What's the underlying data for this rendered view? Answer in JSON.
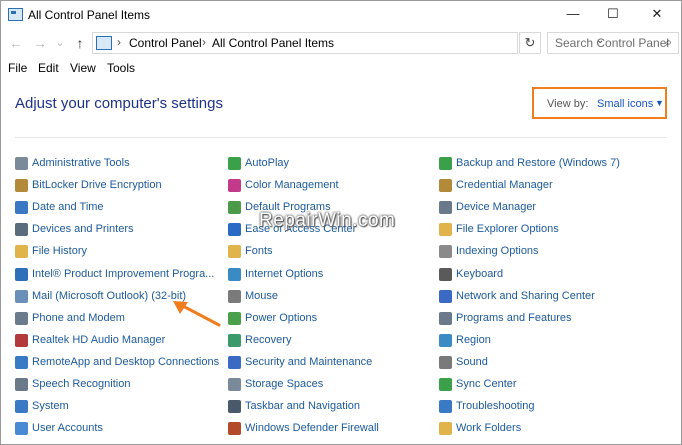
{
  "window": {
    "title": "All Control Panel Items",
    "controls": {
      "minimize": "—",
      "maximize": "☐",
      "close": "✕"
    }
  },
  "nav": {
    "back": "←",
    "forward": "→",
    "dropdown": "⌄",
    "up": "↑",
    "breadcrumb": [
      "Control Panel",
      "All Control Panel Items"
    ],
    "separator": "›",
    "address_dropdown": "⌄",
    "refresh": "↻",
    "search_placeholder": "Search Control Panel",
    "search_icon": "⌕"
  },
  "menu": [
    "File",
    "Edit",
    "View",
    "Tools"
  ],
  "heading": "Adjust your computer's settings",
  "view_by": {
    "label": "View by:",
    "value": "Small icons",
    "caret": "▼"
  },
  "columns": [
    [
      {
        "label": "Administrative Tools",
        "icon": "admin-tools-icon",
        "color": "#7a8a99"
      },
      {
        "label": "BitLocker Drive Encryption",
        "icon": "bitlocker-icon",
        "color": "#b38a3a"
      },
      {
        "label": "Date and Time",
        "icon": "date-time-icon",
        "color": "#3a78c4"
      },
      {
        "label": "Devices and Printers",
        "icon": "devices-printers-icon",
        "color": "#5b6c7e"
      },
      {
        "label": "File History",
        "icon": "file-history-icon",
        "color": "#e0b44a"
      },
      {
        "label": "Intel® Product Improvement Progra...",
        "icon": "intel-icon",
        "color": "#2f6fba"
      },
      {
        "label": "Mail (Microsoft Outlook) (32-bit)",
        "icon": "mail-icon",
        "color": "#6a8fb8"
      },
      {
        "label": "Phone and Modem",
        "icon": "phone-modem-icon",
        "color": "#6b7b8b"
      },
      {
        "label": "Realtek HD Audio Manager",
        "icon": "realtek-icon",
        "color": "#b33a3a"
      },
      {
        "label": "RemoteApp and Desktop Connections",
        "icon": "remoteapp-icon",
        "color": "#3a7ac4"
      },
      {
        "label": "Speech Recognition",
        "icon": "speech-icon",
        "color": "#6a7a8a"
      },
      {
        "label": "System",
        "icon": "system-icon",
        "color": "#3a7ac4"
      },
      {
        "label": "User Accounts",
        "icon": "user-accounts-icon",
        "color": "#4a8ad4"
      }
    ],
    [
      {
        "label": "AutoPlay",
        "icon": "autoplay-icon",
        "color": "#3aa04a"
      },
      {
        "label": "Color Management",
        "icon": "color-management-icon",
        "color": "#c43a8a"
      },
      {
        "label": "Default Programs",
        "icon": "default-programs-icon",
        "color": "#4a9a4a"
      },
      {
        "label": "Ease of Access Center",
        "icon": "ease-of-access-icon",
        "color": "#2a6ac4"
      },
      {
        "label": "Fonts",
        "icon": "fonts-icon",
        "color": "#e0b44a"
      },
      {
        "label": "Internet Options",
        "icon": "internet-options-icon",
        "color": "#3a8ac4"
      },
      {
        "label": "Mouse",
        "icon": "mouse-icon",
        "color": "#7a7a7a"
      },
      {
        "label": "Power Options",
        "icon": "power-options-icon",
        "color": "#4aa04a"
      },
      {
        "label": "Recovery",
        "icon": "recovery-icon",
        "color": "#3a9a6a"
      },
      {
        "label": "Security and Maintenance",
        "icon": "security-flag-icon",
        "color": "#3a6ac4"
      },
      {
        "label": "Storage Spaces",
        "icon": "storage-spaces-icon",
        "color": "#7a8a9a"
      },
      {
        "label": "Taskbar and Navigation",
        "icon": "taskbar-icon",
        "color": "#4a5a6a"
      },
      {
        "label": "Windows Defender Firewall",
        "icon": "firewall-icon",
        "color": "#b34a2a"
      }
    ],
    [
      {
        "label": "Backup and Restore (Windows 7)",
        "icon": "backup-restore-icon",
        "color": "#3aa04a"
      },
      {
        "label": "Credential Manager",
        "icon": "credential-manager-icon",
        "color": "#b38a3a"
      },
      {
        "label": "Device Manager",
        "icon": "device-manager-icon",
        "color": "#6a7a8a"
      },
      {
        "label": "File Explorer Options",
        "icon": "folder-options-icon",
        "color": "#e0b44a"
      },
      {
        "label": "Indexing Options",
        "icon": "indexing-options-icon",
        "color": "#8a8a8a"
      },
      {
        "label": "Keyboard",
        "icon": "keyboard-icon",
        "color": "#5a5a5a"
      },
      {
        "label": "Network and Sharing Center",
        "icon": "network-sharing-icon",
        "color": "#3a6ac4"
      },
      {
        "label": "Programs and Features",
        "icon": "programs-features-icon",
        "color": "#6a7a8a"
      },
      {
        "label": "Region",
        "icon": "region-icon",
        "color": "#3a8ac4"
      },
      {
        "label": "Sound",
        "icon": "sound-icon",
        "color": "#7a7a7a"
      },
      {
        "label": "Sync Center",
        "icon": "sync-center-icon",
        "color": "#3aa04a"
      },
      {
        "label": "Troubleshooting",
        "icon": "troubleshooting-icon",
        "color": "#3a7ac4"
      },
      {
        "label": "Work Folders",
        "icon": "work-folders-icon",
        "color": "#e0b44a"
      }
    ]
  ],
  "watermark": "RepairWin.com",
  "accent_color": "#f07d1e"
}
